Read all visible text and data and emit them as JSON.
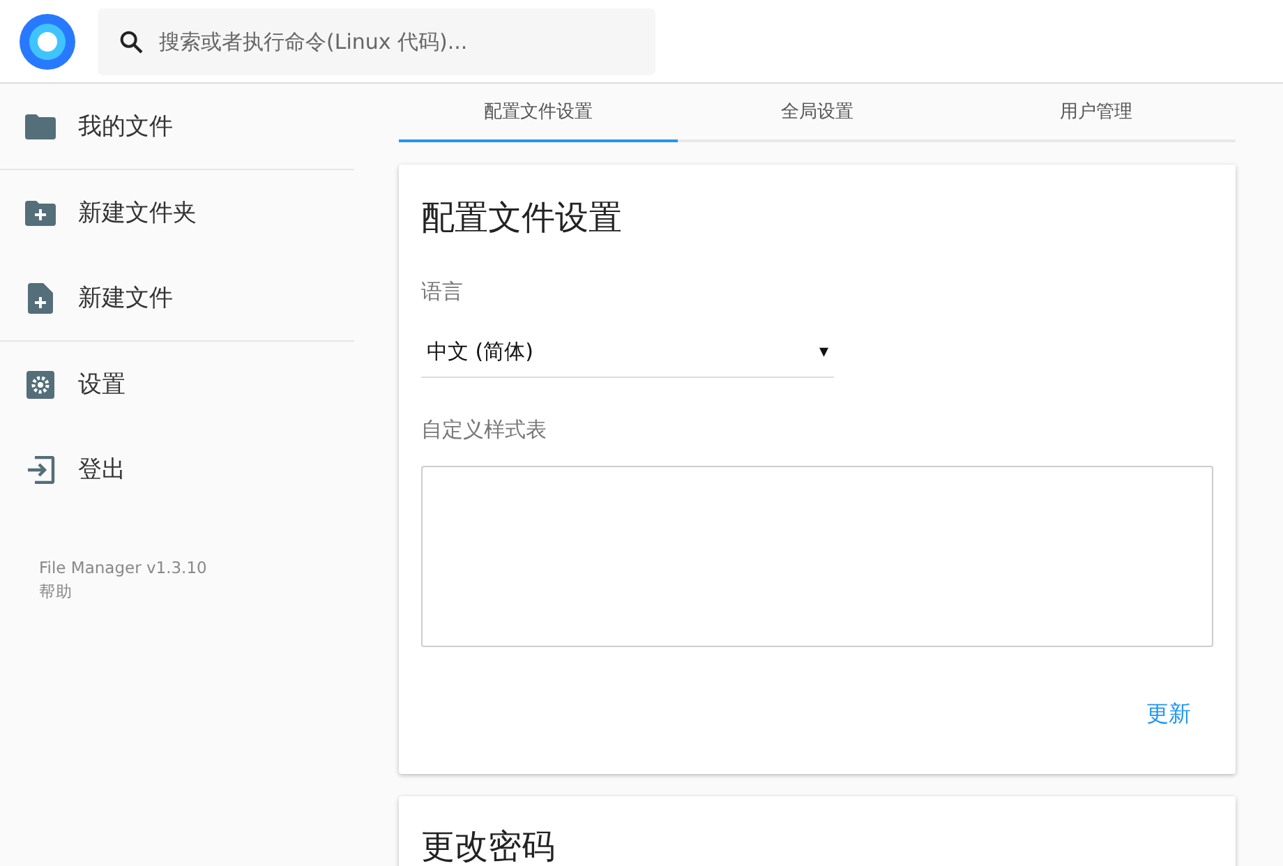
{
  "search": {
    "placeholder": "搜索或者执行命令(Linux 代码)..."
  },
  "sidebar": {
    "groups": [
      [
        {
          "label": "我的文件",
          "kind": "folder"
        }
      ],
      [
        {
          "label": "新建文件夹",
          "kind": "new-folder"
        },
        {
          "label": "新建文件",
          "kind": "new-file"
        }
      ],
      [
        {
          "label": "设置",
          "kind": "settings"
        },
        {
          "label": "登出",
          "kind": "logout"
        }
      ]
    ],
    "footer": [
      "File Manager v1.3.10",
      "帮助"
    ]
  },
  "tabs": [
    {
      "label": "配置文件设置",
      "selected": true
    },
    {
      "label": "全局设置",
      "selected": false
    },
    {
      "label": "用户管理",
      "selected": false
    }
  ],
  "cards": [
    {
      "title": "配置文件设置",
      "language": {
        "label": "语言",
        "value": "中文 (简体)",
        "caret": "▾"
      },
      "stylesheet": {
        "label": "自定义样式表"
      },
      "button": "更新"
    },
    {
      "title": "更改密码"
    }
  ]
}
